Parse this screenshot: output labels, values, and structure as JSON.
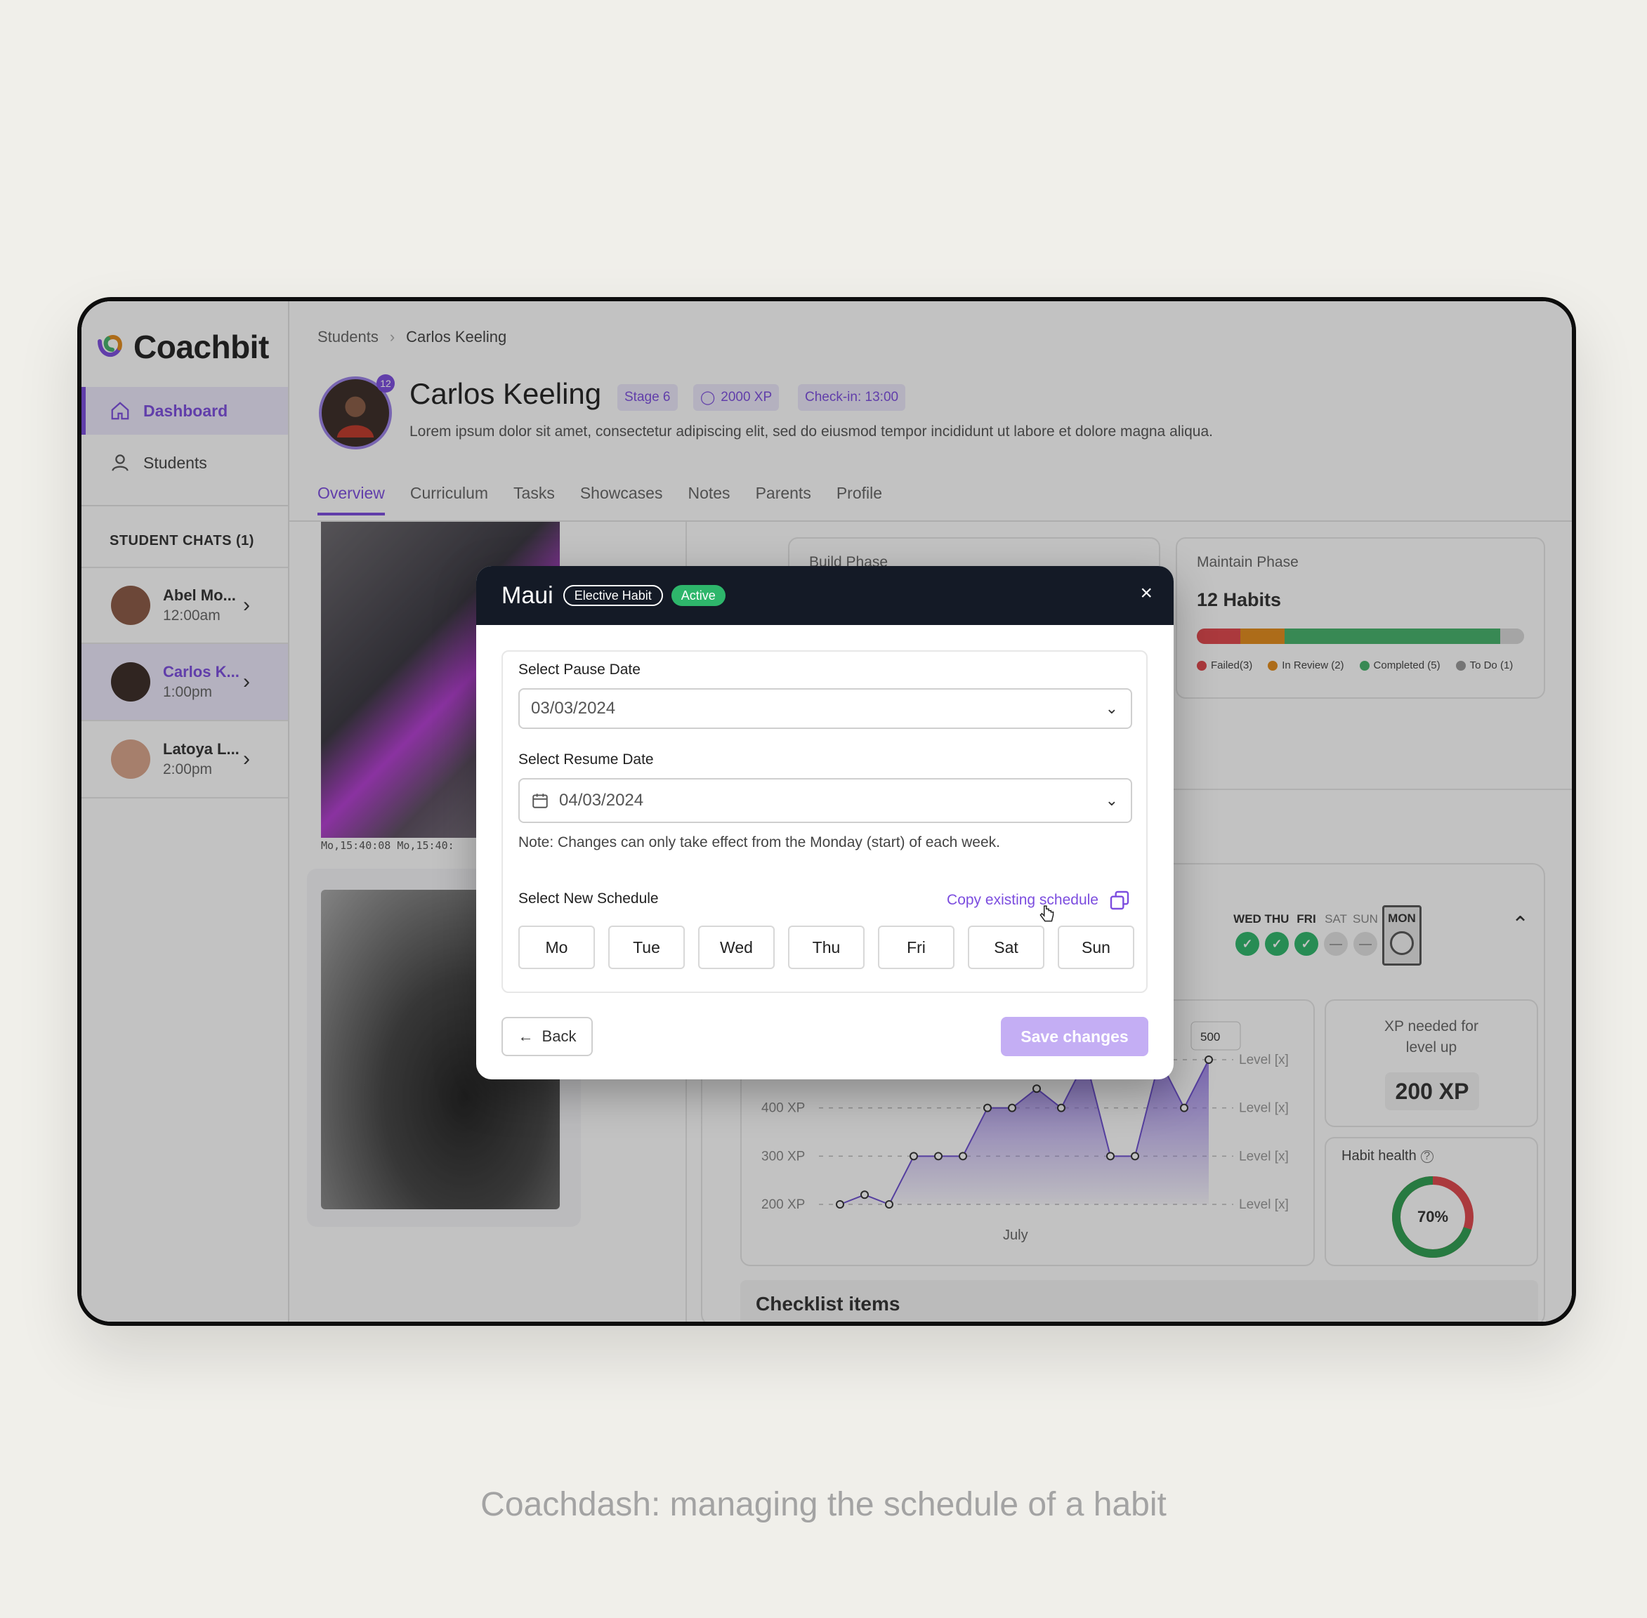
{
  "app": {
    "name": "Coachbit"
  },
  "sidebar": {
    "items": [
      {
        "label": "Dashboard",
        "icon": "home-icon"
      },
      {
        "label": "Students",
        "icon": "user-icon"
      }
    ],
    "chats_header": "STUDENT CHATS (1)",
    "chats": [
      {
        "name": "Abel Mo...",
        "time": "12:00am"
      },
      {
        "name": "Carlos K...",
        "time": "1:00pm"
      },
      {
        "name": "Latoya L...",
        "time": "2:00pm"
      }
    ]
  },
  "breadcrumb": {
    "root": "Students",
    "current": "Carlos Keeling"
  },
  "profile": {
    "name": "Carlos Keeling",
    "badge_count": "12",
    "stage": "Stage 6",
    "xp": "2000 XP",
    "checkin": "Check-in: 13:00",
    "description": "Lorem ipsum dolor sit amet, consectetur adipiscing elit, sed do eiusmod tempor incididunt ut labore et dolore magna aliqua."
  },
  "tabs": [
    "Overview",
    "Curriculum",
    "Tasks",
    "Showcases",
    "Notes",
    "Parents",
    "Profile"
  ],
  "photo_caption": "Mo,15:40:08 Mo,15:40:",
  "build_phase_label": "Build Phase",
  "maintain_phase": {
    "label": "Maintain Phase",
    "value": "12 Habits",
    "progress": [
      {
        "name": "Failed(3)",
        "color": "#e0474c",
        "fraction": 0.134
      },
      {
        "name": "In Review (2)",
        "color": "#e38c1b",
        "fraction": 0.134
      },
      {
        "name": "Completed (5)",
        "color": "#45b36b",
        "fraction": 0.658
      },
      {
        "name": "To Do (1)",
        "color": "#d8d8d8",
        "fraction": 0.074
      }
    ]
  },
  "week": {
    "days": [
      {
        "label": "WED",
        "status": "done"
      },
      {
        "label": "THU",
        "status": "done"
      },
      {
        "label": "FRI",
        "status": "done"
      },
      {
        "label": "SAT",
        "status": "skip"
      },
      {
        "label": "SUN",
        "status": "skip"
      },
      {
        "label": "MON",
        "status": "current"
      }
    ]
  },
  "chart_data": {
    "type": "area",
    "title": "",
    "xlabel": "July",
    "ylabel": "",
    "y_ticks": [
      "200 XP",
      "300 XP",
      "400 XP"
    ],
    "right_labels": [
      "Level [x]",
      "Level [x]",
      "Level [x]",
      "Level [x]"
    ],
    "tooltip": "500",
    "ylim": [
      200,
      500
    ],
    "points": [
      [
        0,
        200
      ],
      [
        1,
        220
      ],
      [
        2,
        200
      ],
      [
        3,
        300
      ],
      [
        4,
        300
      ],
      [
        5,
        300
      ],
      [
        6,
        400
      ],
      [
        7,
        400
      ],
      [
        8,
        440
      ],
      [
        9,
        400
      ],
      [
        10,
        500
      ],
      [
        11,
        300
      ],
      [
        12,
        300
      ],
      [
        13,
        500
      ],
      [
        14,
        400
      ],
      [
        15,
        500
      ]
    ]
  },
  "xp_card": {
    "label": "XP needed for level up",
    "value": "200 XP"
  },
  "habit_health": {
    "label": "Habit health",
    "value": "70%",
    "fraction": 0.7,
    "fill_color": "#2f9e52",
    "rest_color": "#e0474c"
  },
  "checklist": {
    "title": "Checklist items"
  },
  "modal": {
    "title": "Maui",
    "tag": "Elective Habit",
    "status": "Active",
    "close": "×",
    "pause_label": "Select Pause Date",
    "pause_value": "03/03/2024",
    "resume_label": "Select Resume Date",
    "resume_value": "04/03/2024",
    "note": "Note: Changes can only take effect from the Monday (start) of each week.",
    "schedule_label": "Select New Schedule",
    "copy_label": "Copy existing schedule",
    "days": [
      "Mo",
      "Tue",
      "Wed",
      "Thu",
      "Fri",
      "Sat",
      "Sun"
    ],
    "back": "Back",
    "save": "Save changes"
  },
  "caption": "Coachdash: managing the schedule of a habit",
  "colors": {
    "accent": "#7c4ddf",
    "modal_header": "#141a26",
    "active_green": "#2eb66b"
  }
}
